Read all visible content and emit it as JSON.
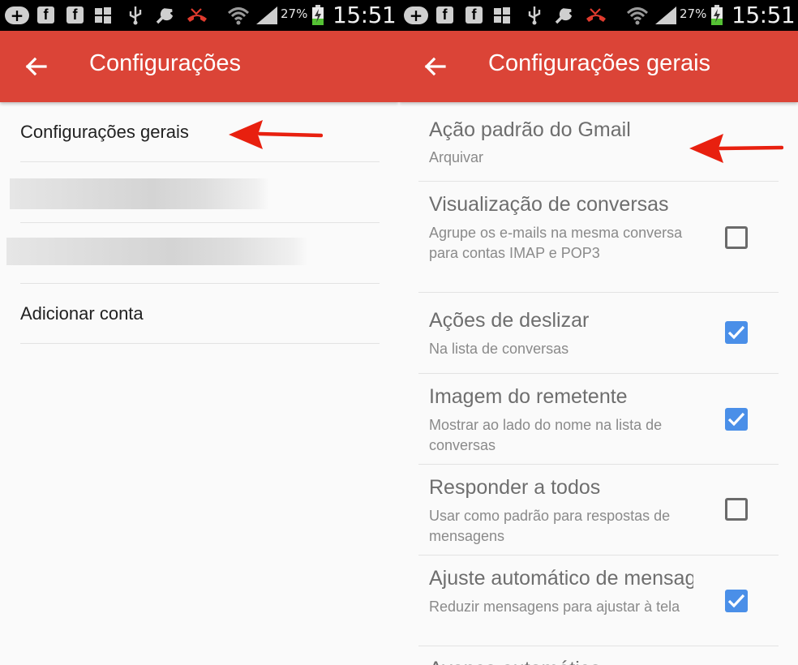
{
  "status_bar": {
    "facebook_glyph": "f",
    "battery_percent": "27%",
    "time": "15:51",
    "icons": [
      "add-icon",
      "facebook-icon",
      "facebook-icon",
      "windows-icon",
      "usb-icon",
      "wrench-icon",
      "missed-call-icon",
      "wifi-icon",
      "signal-icon",
      "battery-charging-icon"
    ]
  },
  "left_screen": {
    "title": "Configurações",
    "items": [
      {
        "label": "Configurações gerais"
      },
      {
        "label": "Adicionar conta"
      }
    ]
  },
  "right_screen": {
    "title": "Configurações gerais",
    "settings": [
      {
        "title": "Ação padrão do Gmail",
        "subtitle": "Arquivar"
      },
      {
        "title": "Visualização de conversas",
        "subtitle": "Agrupe os e-mails na mesma conversa para contas IMAP e POP3",
        "checked": false
      },
      {
        "title": "Ações de deslizar",
        "subtitle": "Na lista de conversas",
        "checked": true
      },
      {
        "title": "Imagem do remetente",
        "subtitle": "Mostrar ao lado do nome na lista de conversas",
        "checked": true
      },
      {
        "title": "Responder a todos",
        "subtitle": "Usar como padrão para respostas de mensagens",
        "checked": false
      },
      {
        "title": "Ajuste automático de mensagens",
        "subtitle": "Reduzir mensagens para ajustar à tela",
        "checked": true
      },
      {
        "title": "Avanço automático"
      }
    ]
  },
  "colors": {
    "appbar": "#db4437",
    "checkbox_checked": "#4a8fe8",
    "annotation_arrow": "#e8200f"
  }
}
